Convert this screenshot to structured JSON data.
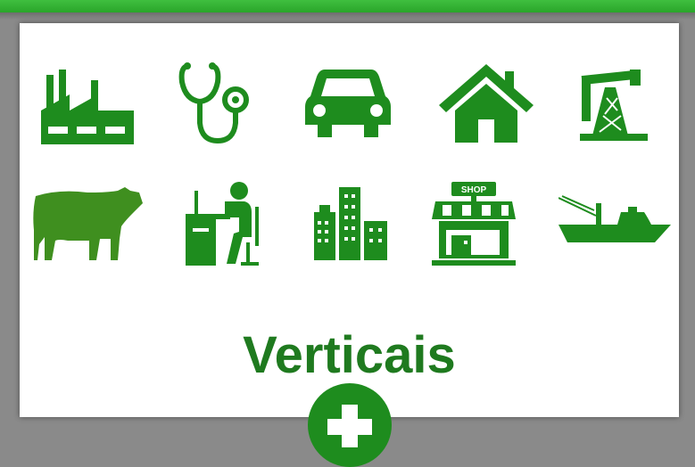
{
  "colors": {
    "accent": "#1e8c1e",
    "title": "#1f7a1f",
    "cow": "#3f8f1f",
    "top_bar": "#2eb02e"
  },
  "icons": [
    "factory-icon",
    "stethoscope-icon",
    "car-icon",
    "house-icon",
    "oil-pump-icon",
    "cow-icon",
    "office-worker-icon",
    "city-buildings-icon",
    "shop-icon",
    "fishing-boat-icon"
  ],
  "shop_sign_text": "SHOP",
  "title": "Verticais",
  "plus_button_icon": "plus-icon"
}
